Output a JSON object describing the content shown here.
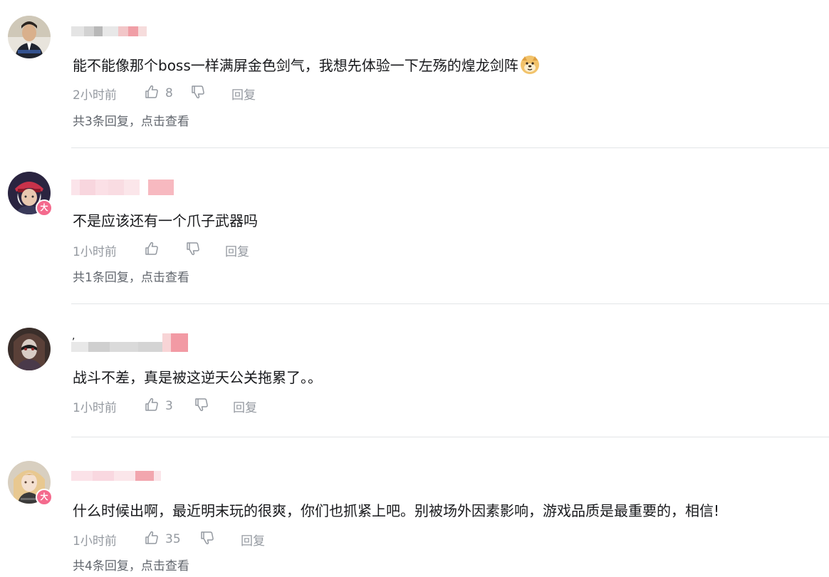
{
  "comments": [
    {
      "text": "能不能像那个boss一样满屏金色剑气，我想先体验一下左殇的煌龙剑阵",
      "emoji_icon": "doge-emoji-icon",
      "time": "2小时前",
      "likes": "8",
      "reply_label": "回复",
      "replies_text": "共3条回复，点击查看"
    },
    {
      "text": "不是应该还有一个爪子武器吗",
      "time": "1小时前",
      "likes": "",
      "reply_label": "回复",
      "replies_text": "共1条回复，点击查看",
      "badge": "大"
    },
    {
      "text": "战斗不差，真是被这逆天公关拖累了。。",
      "time": "1小时前",
      "likes": "3",
      "reply_label": "回复",
      "username_prefix": ","
    },
    {
      "text": "什么时候出啊，最近明末玩的很爽，你们也抓紧上吧。别被场外因素影响，游戏品质是最重要的，相信!",
      "time": "1小时前",
      "likes": "35",
      "reply_label": "回复",
      "replies_text": "共4条回复，点击查看",
      "badge": "大"
    }
  ],
  "colors": {
    "text": "#18191c",
    "meta": "#9499a0",
    "replies": "#61666d",
    "divider": "#e3e5e7",
    "vip_badge": "#f46a8d",
    "blur_gray": "#d6d6d6",
    "blur_pink": "#f5b3b8"
  }
}
